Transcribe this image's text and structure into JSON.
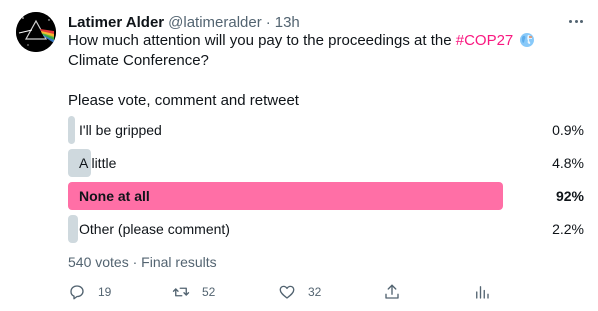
{
  "tweet": {
    "author_name": "Latimer Alder",
    "handle": "@latimeralder",
    "separator": "·",
    "time": "13h",
    "text_before_hashtag": "How much attention will you pay to the proceedings at the ",
    "hashtag": "#COP27",
    "text_after_hashtag": " Climate Conference?",
    "text_para2": "Please vote, comment and retweet"
  },
  "poll": {
    "options": [
      {
        "label": "I'll be gripped",
        "percent_text": "0.9%",
        "percent": 0.9,
        "winner": false
      },
      {
        "label": "A little",
        "percent_text": "4.8%",
        "percent": 4.8,
        "winner": false
      },
      {
        "label": "None at all",
        "percent_text": "92%",
        "percent": 92,
        "winner": true
      },
      {
        "label": "Other (please comment)",
        "percent_text": "2.2%",
        "percent": 2.2,
        "winner": false
      }
    ],
    "votes": "540 votes",
    "separator": "·",
    "status": "Final results"
  },
  "actions": {
    "replies": "19",
    "retweets": "52",
    "likes": "32"
  },
  "colors": {
    "winner_bar": "#ff6fa6",
    "bar": "#cfd9de",
    "hashtag": "#f91880",
    "muted": "#536471"
  },
  "icons": [
    "reply-icon",
    "retweet-icon",
    "like-icon",
    "share-icon",
    "analytics-icon",
    "more-icon",
    "globe-emoji-icon"
  ]
}
